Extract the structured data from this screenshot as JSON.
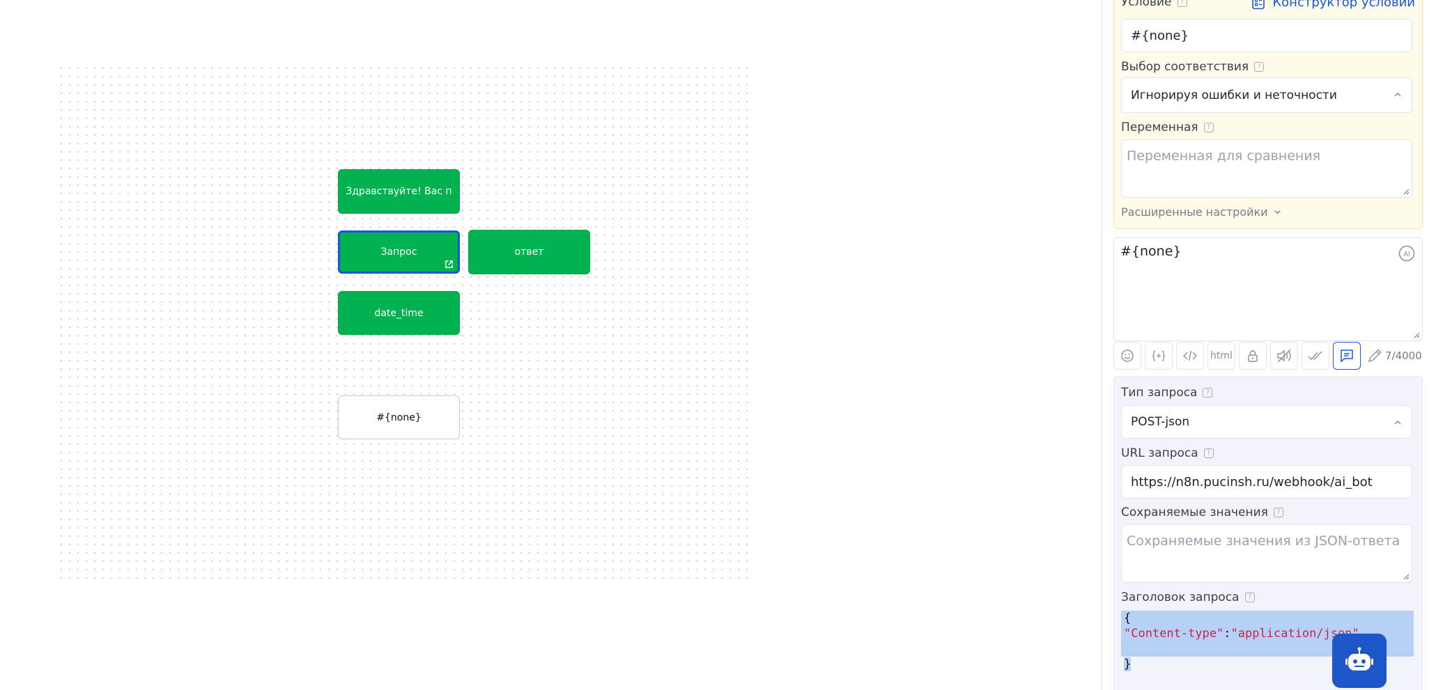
{
  "canvas": {
    "nodes": [
      {
        "id": "greeting",
        "label": "Здравствуйте!  Вас п",
        "style": "green"
      },
      {
        "id": "request",
        "label": "Запрос",
        "style": "green",
        "selected": true
      },
      {
        "id": "answer",
        "label": "ответ",
        "style": "green"
      },
      {
        "id": "date_time",
        "label": "date_time",
        "style": "green"
      },
      {
        "id": "none",
        "label": "#{none}",
        "style": "white"
      }
    ]
  },
  "panel": {
    "condition": {
      "label": "Условие",
      "builder_link": "Конструктор условий",
      "value": "#{none}"
    },
    "match": {
      "label": "Выбор соответствия",
      "value": "Игнорируя ошибки и неточности"
    },
    "variable": {
      "label": "Переменная",
      "placeholder": "Переменная для сравнения"
    },
    "advanced": {
      "label": "Расширенные настройки"
    },
    "message": {
      "value": "#{none}"
    },
    "toolbar": {
      "html_label": "html",
      "counter": "7/4000",
      "tools": [
        "emoji-icon",
        "variable-icon",
        "code-icon",
        "html",
        "lock-icon",
        "mute-icon",
        "double-check-icon",
        "comment-icon",
        "pencil-icon"
      ]
    },
    "request": {
      "type_label": "Тип запроса",
      "type_value": "POST-json",
      "url_label": "URL запроса",
      "url_value": "https://n8n.pucinsh.ru/webhook/ai_bot",
      "saved_label": "Сохраняемые значения",
      "saved_placeholder": "Сохраняемые значения из JSON-ответа",
      "header_label": "Заголовок запроса",
      "header_lines": [
        "{",
        "\"Content-type\"",
        ":",
        "\"application/json\"",
        "}"
      ]
    },
    "ai_badge": "AI"
  },
  "colors": {
    "node_green": "#02b14f",
    "accent": "#1a56db",
    "condition_bg": "#fffbeb",
    "request_bg": "#f3f3fc"
  }
}
